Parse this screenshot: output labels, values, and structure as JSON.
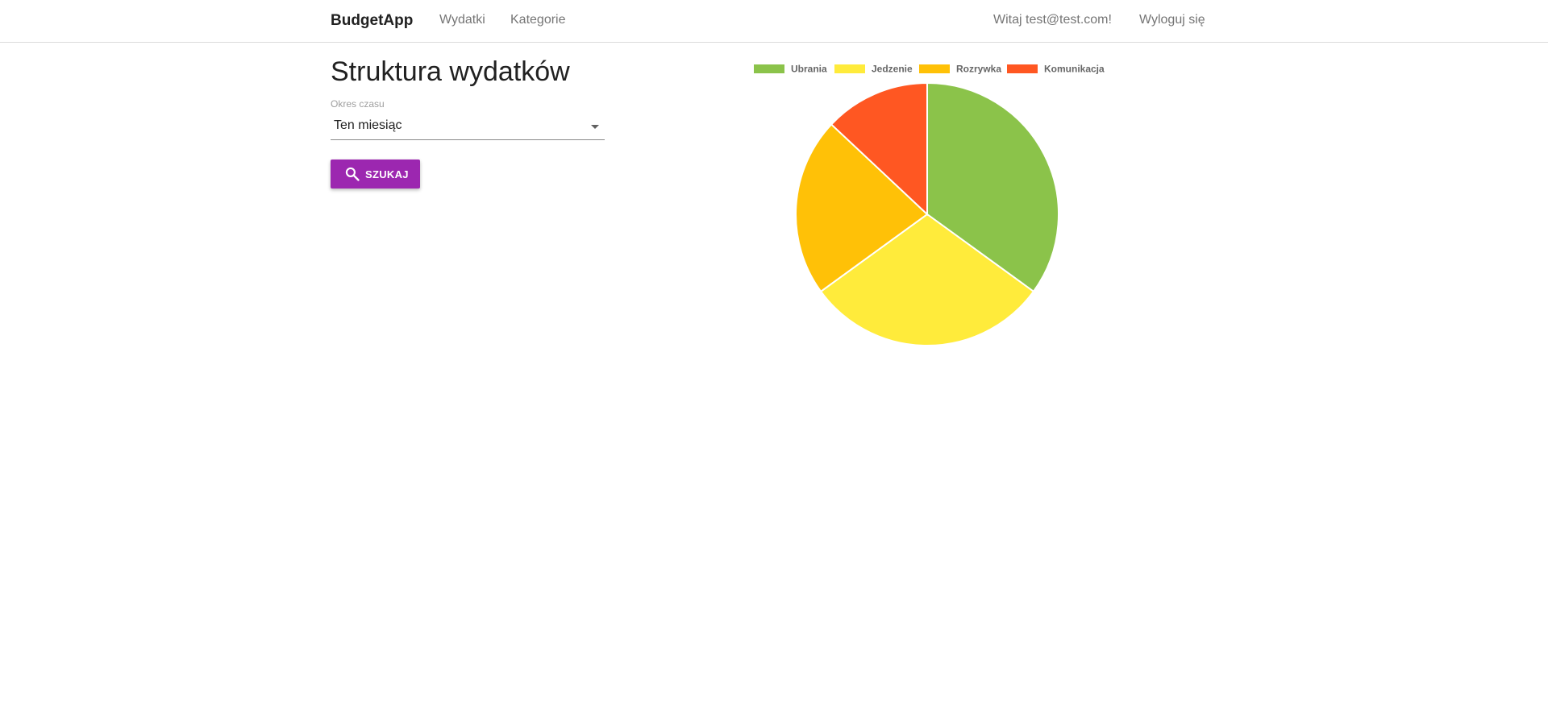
{
  "navbar": {
    "brand": "BudgetApp",
    "links": [
      "Wydatki",
      "Kategorie"
    ],
    "welcome": "Witaj test@test.com!",
    "logout": "Wyloguj się"
  },
  "main": {
    "title": "Struktura wydatków",
    "period_label": "Okres czasu",
    "period_value": "Ten miesiąc",
    "search_label": "SZUKAJ"
  },
  "icons": {
    "search": "search-icon",
    "dropdown": "chevron-down-icon"
  },
  "colors": {
    "accent": "#9c27b0"
  },
  "chart_data": {
    "type": "pie",
    "categories": [
      "Ubrania",
      "Jedzenie",
      "Rozrywka",
      "Komunikacja"
    ],
    "values": [
      35,
      30,
      22,
      13
    ],
    "colors": [
      "#8bc34a",
      "#ffeb3b",
      "#ffc107",
      "#ff5722"
    ],
    "legend": "top"
  }
}
